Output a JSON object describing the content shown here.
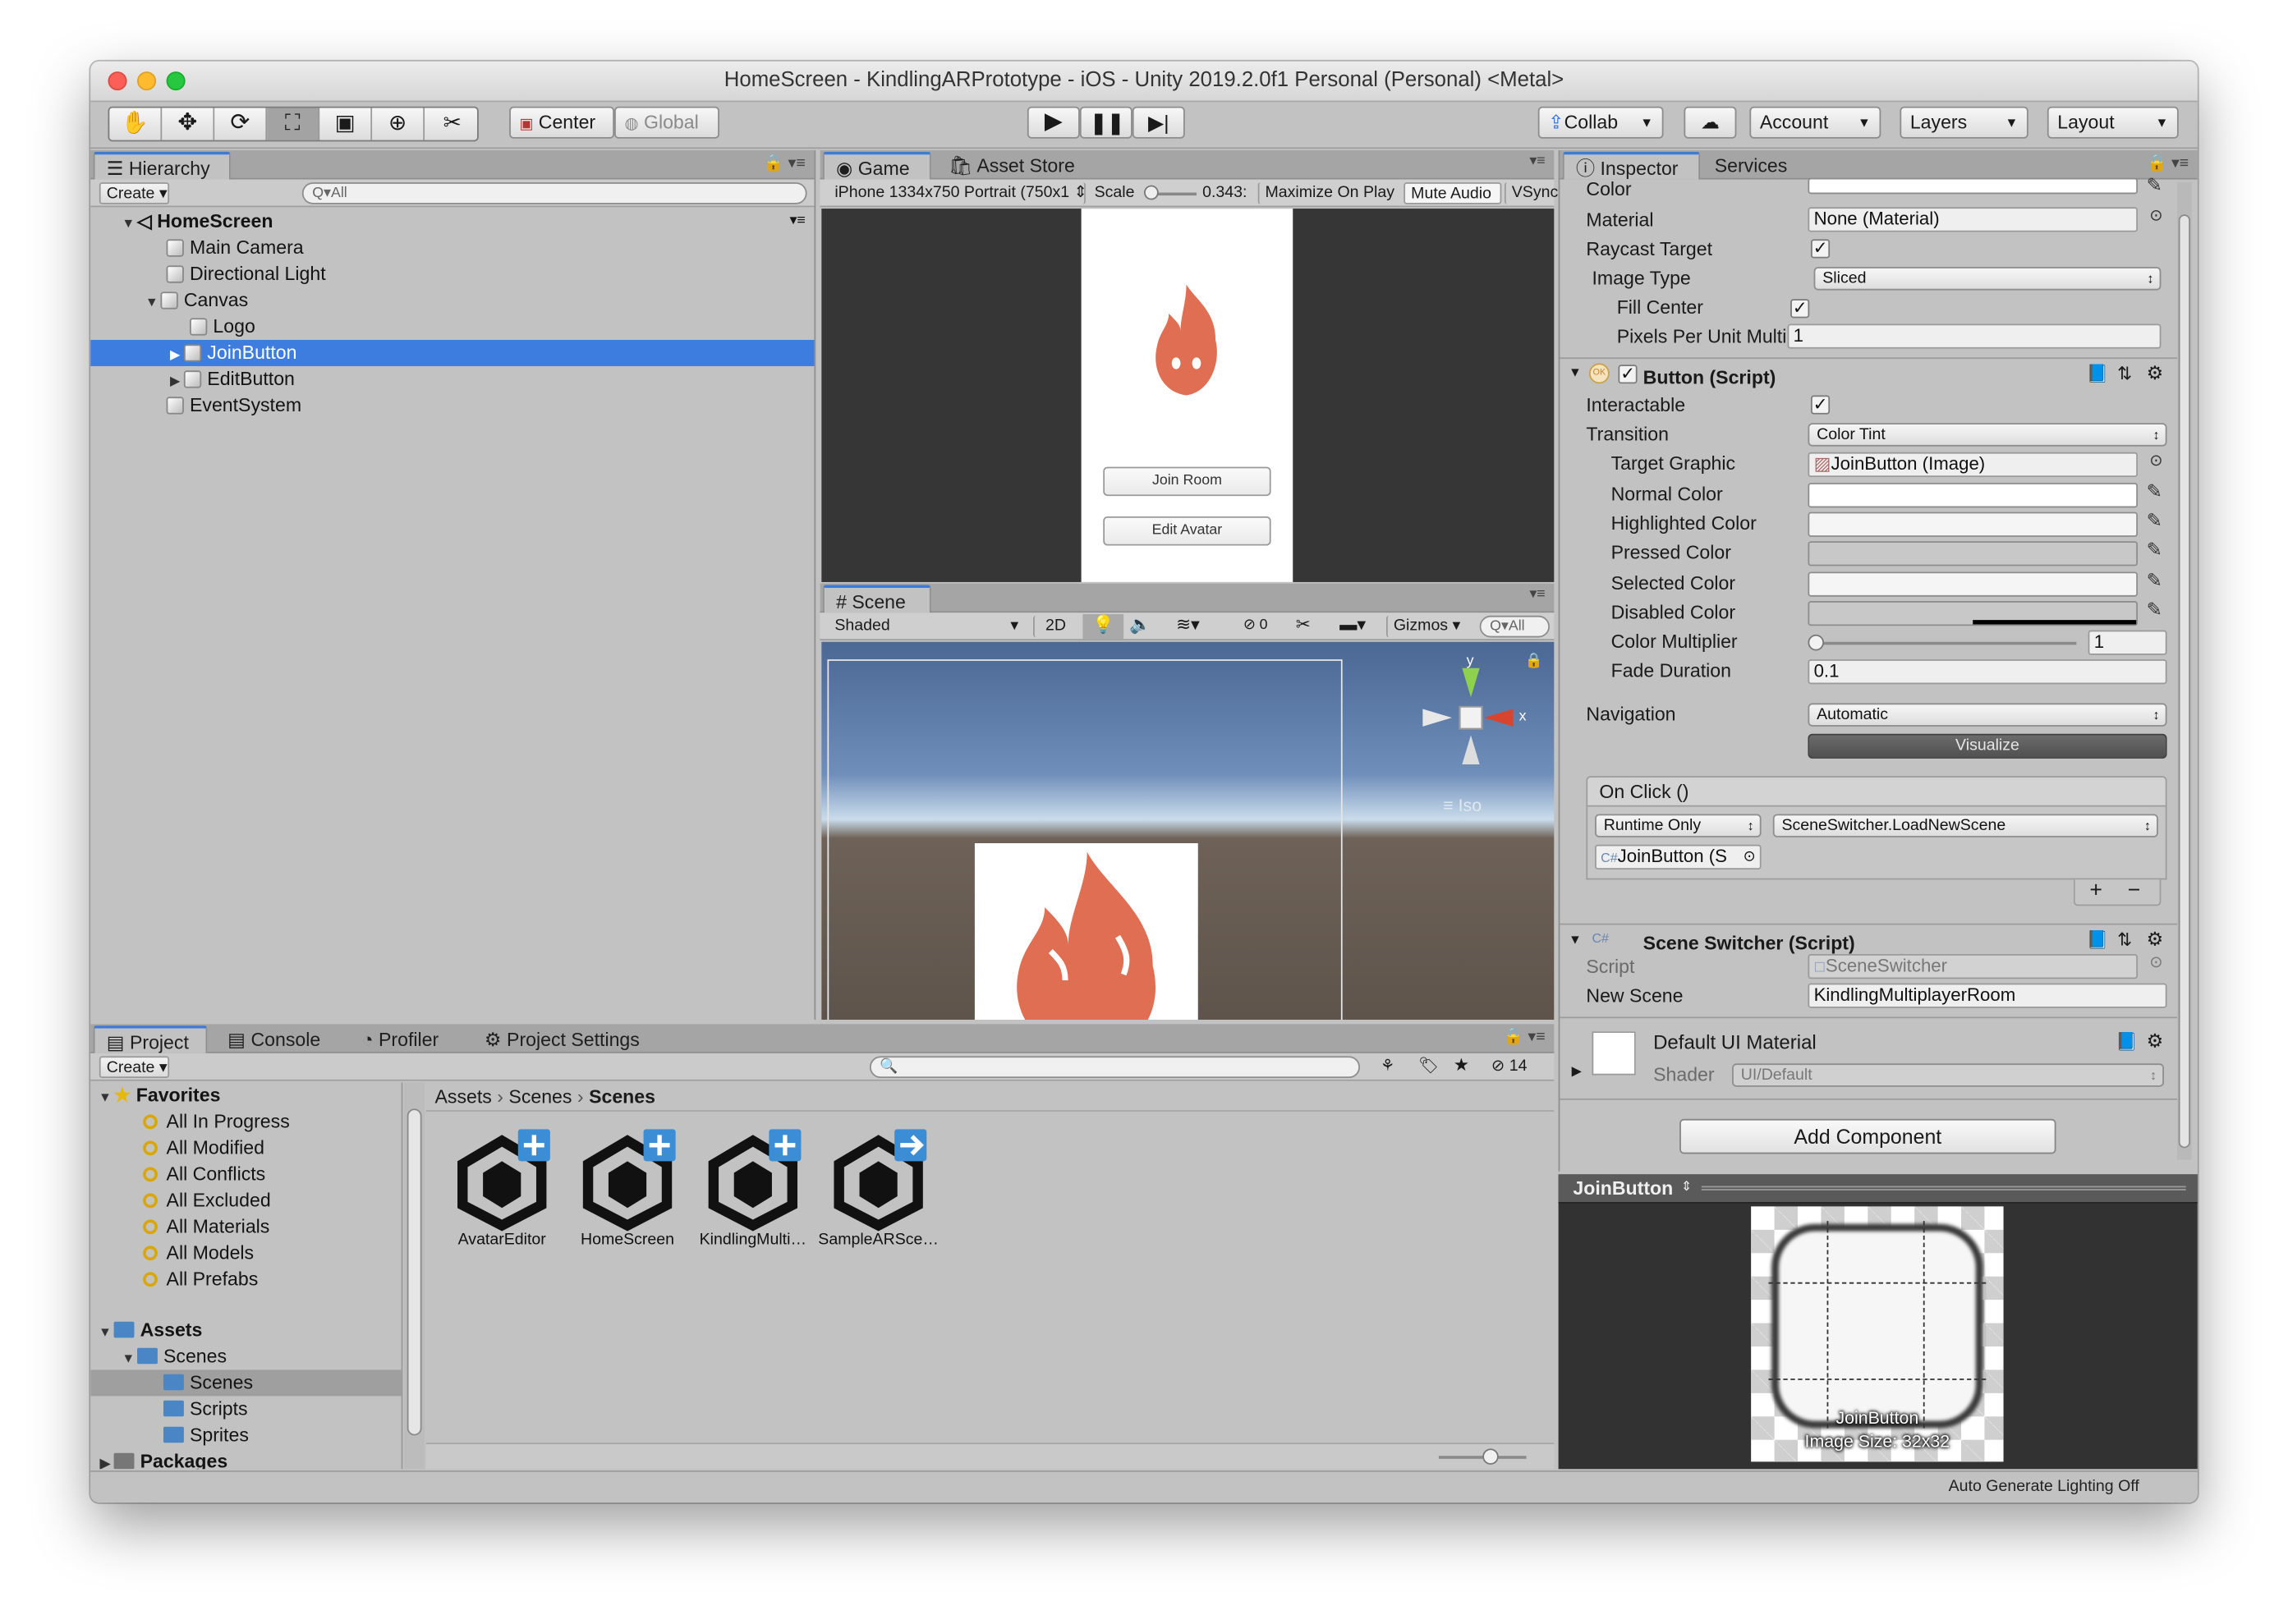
{
  "window": {
    "title": "HomeScreen - KindlingARPrototype - iOS - Unity 2019.2.0f1 Personal (Personal) <Metal>"
  },
  "toolbar": {
    "tools": [
      "hand-tool",
      "move-tool",
      "rotate-tool",
      "scale-tool",
      "rect-tool",
      "transform-tool",
      "custom-tool"
    ],
    "pivot": "Center",
    "space": "Global",
    "collab": "Collab",
    "account": "Account",
    "layers": "Layers",
    "layout": "Layout"
  },
  "hierarchy": {
    "tab": "Hierarchy",
    "create": "Create",
    "search_placeholder": "All",
    "scene": "HomeScreen",
    "items": [
      "Main Camera",
      "Directional Light",
      "Canvas",
      "Logo",
      "JoinButton",
      "EditButton",
      "EventSystem"
    ]
  },
  "game": {
    "tab": "Game",
    "tab2": "Asset Store",
    "resolution": "iPhone 1334x750 Portrait (750x1",
    "scale_label": "Scale",
    "scale_value": "0.343:",
    "maximize": "Maximize On Play",
    "mute": "Mute Audio",
    "vsync": "VSync",
    "buttons": [
      "Join Room",
      "Edit Avatar"
    ]
  },
  "scene": {
    "tab": "Scene",
    "shading": "Shaded",
    "mode2d": "2D",
    "fx_count": "0",
    "gizmos": "Gizmos",
    "search_placeholder": "All",
    "axis_y": "y",
    "axis_x": "x",
    "iso": "Iso"
  },
  "inspector": {
    "tab": "Inspector",
    "tab2": "Services",
    "image_rows": {
      "color": "Color",
      "material": "Material",
      "material_value": "None (Material)",
      "raycast": "Raycast Target",
      "image_type": "Image Type",
      "image_type_value": "Sliced",
      "fill_center": "Fill Center",
      "ppu": "Pixels Per Unit Multi",
      "ppu_value": "1"
    },
    "button": {
      "header": "Button (Script)",
      "interactable": "Interactable",
      "transition": "Transition",
      "transition_value": "Color Tint",
      "target_graphic": "Target Graphic",
      "target_graphic_value": "JoinButton (Image)",
      "normal": "Normal Color",
      "highlighted": "Highlighted Color",
      "pressed": "Pressed Color",
      "selected": "Selected Color",
      "disabled": "Disabled Color",
      "multiplier": "Color Multiplier",
      "multiplier_value": "1",
      "multiplier_level": 0,
      "fade": "Fade Duration",
      "fade_value": "0.1",
      "navigation": "Navigation",
      "navigation_value": "Automatic",
      "visualize": "Visualize",
      "onclick": "On Click ()",
      "runtime": "Runtime Only",
      "function": "SceneSwitcher.LoadNewScene",
      "object": "JoinButton (S"
    },
    "switcher": {
      "header": "Scene Switcher (Script)",
      "script": "Script",
      "script_value": "SceneSwitcher",
      "new_scene": "New Scene",
      "new_scene_value": "KindlingMultiplayerRoom"
    },
    "material": {
      "name": "Default UI Material",
      "shader": "Shader",
      "shader_value": "UI/Default"
    },
    "add_component": "Add Component",
    "preview": {
      "title": "JoinButton",
      "name": "JoinButton",
      "size": "Image Size: 32x32"
    }
  },
  "project": {
    "tabs": [
      "Project",
      "Console",
      "Profiler",
      "Project Settings"
    ],
    "create": "Create",
    "count": "14",
    "favorites": "Favorites",
    "fav_items": [
      "All In Progress",
      "All Modified",
      "All Conflicts",
      "All Excluded",
      "All Materials",
      "All Models",
      "All Prefabs"
    ],
    "assets": "Assets",
    "scenes_folder": "Scenes",
    "subfolders": [
      "Scenes",
      "Scripts",
      "Sprites"
    ],
    "packages": "Packages",
    "breadcrumb": [
      "Assets",
      "Scenes",
      "Scenes"
    ],
    "files": [
      "AvatarEditor",
      "HomeScreen",
      "KindlingMulti…",
      "SampleARSce…"
    ]
  },
  "status": {
    "text": "Auto Generate Lighting Off"
  },
  "colors": {
    "accent": "#3e7de0",
    "flame": "#df6e52",
    "panel": "#c2c2c2"
  }
}
